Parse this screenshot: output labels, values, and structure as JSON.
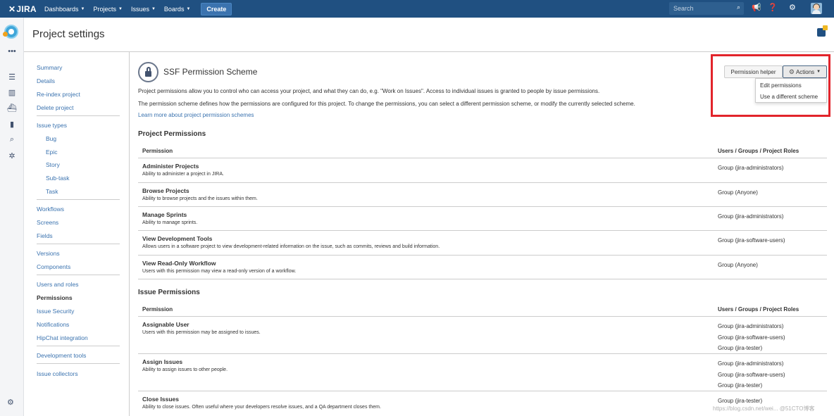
{
  "topnav": {
    "logo": "JIRA",
    "menus": [
      "Dashboards",
      "Projects",
      "Issues",
      "Boards"
    ],
    "create_label": "Create",
    "search_placeholder": "Search"
  },
  "page": {
    "title": "Project settings"
  },
  "sidebar": {
    "groups": [
      [
        "Summary",
        "Details",
        "Re-index project",
        "Delete project"
      ],
      [
        "Issue types",
        "Bug",
        "Epic",
        "Story",
        "Sub-task",
        "Task"
      ],
      [
        "Workflows",
        "Screens",
        "Fields"
      ],
      [
        "Versions",
        "Components"
      ],
      [
        "Users and roles",
        "Permissions",
        "Issue Security",
        "Notifications",
        "HipChat integration"
      ],
      [
        "Development tools"
      ],
      [
        "Issue collectors"
      ]
    ],
    "active": "Permissions"
  },
  "scheme": {
    "title": "SSF Permission Scheme",
    "para1": "Project permissions allow you to control who can access your project, and what they can do, e.g. \"Work on Issues\". Access to individual issues is granted to people by issue permissions.",
    "para2": "The permission scheme defines how the permissions are configured for this project. To change the permissions, you can select a different permission scheme, or modify the currently selected scheme.",
    "learn_link": "Learn more about project permission schemes",
    "permission_helper": "Permission helper",
    "actions_label": "Actions",
    "actions_menu": [
      "Edit permissions",
      "Use a different scheme"
    ]
  },
  "table_headers": {
    "permission": "Permission",
    "holders": "Users / Groups / Project Roles"
  },
  "project_permissions": {
    "title": "Project Permissions",
    "rows": [
      {
        "name": "Administer Projects",
        "desc": "Ability to administer a project in JIRA.",
        "holders": [
          "Group (jira-administrators)"
        ]
      },
      {
        "name": "Browse Projects",
        "desc": "Ability to browse projects and the issues within them.",
        "holders": [
          "Group (Anyone)"
        ]
      },
      {
        "name": "Manage Sprints",
        "desc": "Ability to manage sprints.",
        "holders": [
          "Group (jira-administrators)"
        ]
      },
      {
        "name": "View Development Tools",
        "desc": "Allows users in a software project to view development-related information on the issue, such as commits, reviews and build information.",
        "holders": [
          "Group (jira-software-users)"
        ]
      },
      {
        "name": "View Read-Only Workflow",
        "desc": "Users with this permission may view a read-only version of a workflow.",
        "holders": [
          "Group (Anyone)"
        ]
      }
    ]
  },
  "issue_permissions": {
    "title": "Issue Permissions",
    "rows": [
      {
        "name": "Assignable User",
        "desc": "Users with this permission may be assigned to issues.",
        "holders": [
          "Group (jira-administrators)",
          "Group (jira-software-users)",
          "Group (jira-tester)"
        ]
      },
      {
        "name": "Assign Issues",
        "desc": "Ability to assign issues to other people.",
        "holders": [
          "Group (jira-administrators)",
          "Group (jira-software-users)",
          "Group (jira-tester)"
        ]
      },
      {
        "name": "Close Issues",
        "desc": "Ability to close issues. Often useful where your developers resolve issues, and a QA department closes them.",
        "holders": [
          "Group (jira-tester)"
        ]
      }
    ]
  },
  "watermark": "https://blog.csdn.net/wei... @51CTO博客",
  "colors": {
    "nav": "#205081",
    "link": "#3b73af",
    "highlight": "#e2242b"
  }
}
